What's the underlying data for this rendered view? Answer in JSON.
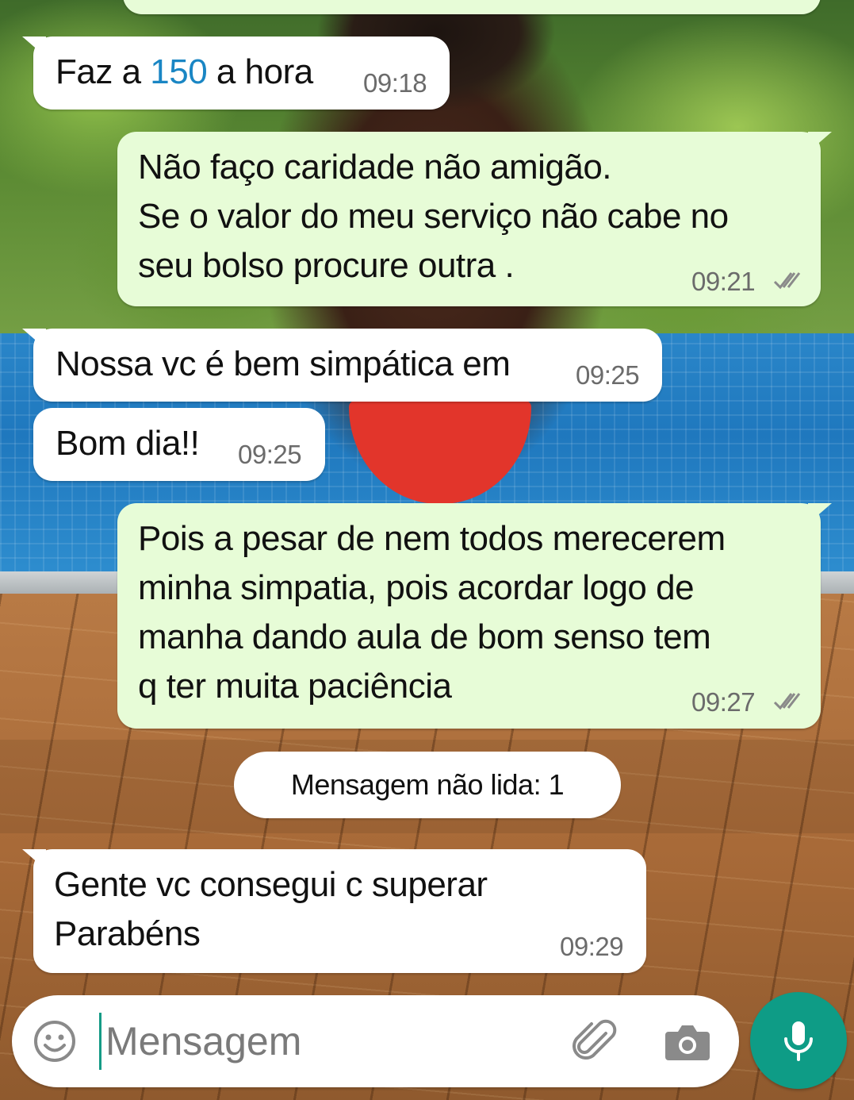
{
  "messages": [
    {
      "id": "m0",
      "direction": "in",
      "text_before": "Faz a ",
      "text_highlight": "150",
      "text_after": " a hora",
      "time": "09:18"
    },
    {
      "id": "m1",
      "direction": "out",
      "text": "Não faço caridade não amigão.\nSe o valor do meu serviço não cabe no\nseu bolso procure outra .",
      "time": "09:21",
      "status_icon": "double-check-icon"
    },
    {
      "id": "m2",
      "direction": "in",
      "text": "Nossa vc é bem simpática em",
      "time": "09:25"
    },
    {
      "id": "m3",
      "direction": "in",
      "text": "Bom dia!!",
      "time": "09:25"
    },
    {
      "id": "m4",
      "direction": "out",
      "text": "Pois a pesar de nem todos merecerem\nminha simpatia,   pois acordar logo de\nmanha dando aula de bom senso tem\nq ter muita paciência",
      "time": "09:27",
      "status_icon": "double-check-icon"
    },
    {
      "id": "m5",
      "direction": "in",
      "text": "Gente vc  consegui c superar\nParabéns",
      "time": "09:29"
    }
  ],
  "unread_banner": "Mensagem não lida: 1",
  "input": {
    "placeholder": "Mensagem",
    "value": ""
  },
  "icons": {
    "emoji": "emoji-icon",
    "attach": "paperclip-icon",
    "camera": "camera-icon",
    "mic": "microphone-icon"
  },
  "colors": {
    "incoming_bubble": "#ffffff",
    "outgoing_bubble": "#e7fcd7",
    "accent": "#0e9c86",
    "link_number": "#1a86c4",
    "timestamp": "#6b6b6b"
  }
}
